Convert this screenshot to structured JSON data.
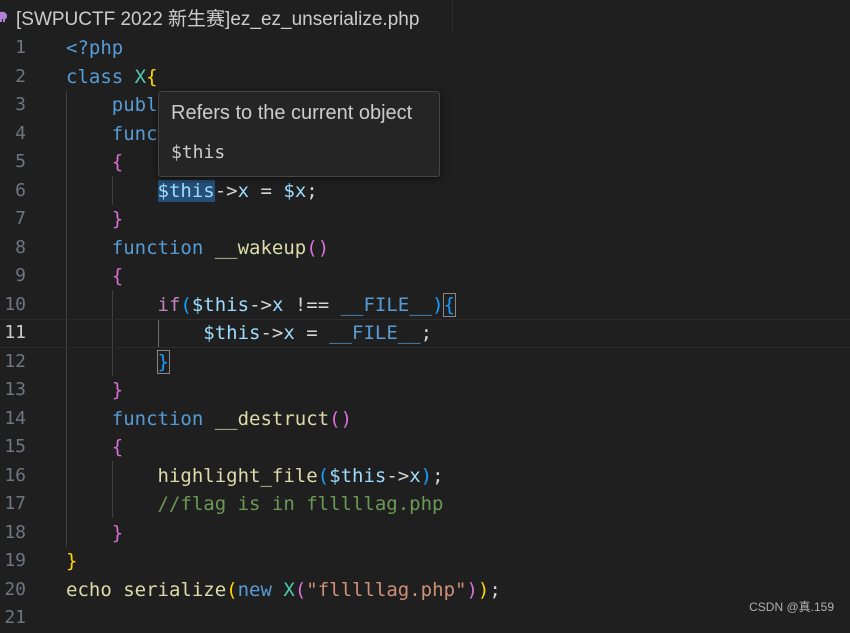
{
  "tab": {
    "title": "[SWPUCTF 2022 新生赛]ez_ez_unserialize.php",
    "icon": "php-elephant-icon"
  },
  "editor": {
    "line_numbers": [
      "1",
      "2",
      "3",
      "4",
      "5",
      "6",
      "7",
      "8",
      "9",
      "10",
      "11",
      "12",
      "13",
      "14",
      "15",
      "16",
      "17",
      "18",
      "19",
      "20",
      "21"
    ],
    "current_line": 11,
    "code": {
      "l1": "<?php",
      "l2_kw": "class",
      "l2_cls": "X",
      "l2_br": "{",
      "l3": "publ",
      "l4": "func",
      "l5": "{",
      "l6_var": "$this",
      "l6_op": "->",
      "l6_prop": "x",
      "l6_eq": " = ",
      "l6_var2": "$x",
      "l6_end": ";",
      "l7": "}",
      "l8_kw": "function",
      "l8_fn": "__wakeup",
      "l8_p": "()",
      "l9": "{",
      "l10_kw": "if",
      "l10_p1": "(",
      "l10_var": "$this",
      "l10_op": "->",
      "l10_prop": "x",
      "l10_cmp": " !== ",
      "l10_const": "__FILE__",
      "l10_p2": ")",
      "l10_br": "{",
      "l11_var": "$this",
      "l11_op": "->",
      "l11_prop": "x",
      "l11_eq": " = ",
      "l11_const": "__FILE__",
      "l11_end": ";",
      "l12": "}",
      "l13": "}",
      "l14_kw": "function",
      "l14_fn": "__destruct",
      "l14_p": "()",
      "l15": "{",
      "l16_fn": "highlight_file",
      "l16_p1": "(",
      "l16_var": "$this",
      "l16_op": "->",
      "l16_prop": "x",
      "l16_p2": ")",
      "l16_end": ";",
      "l17": "//flag is in flllllag.php",
      "l18": "}",
      "l19": "}",
      "l20_fn": "echo serialize",
      "l20_p1": "(",
      "l20_kw": "new",
      "l20_cls": "X",
      "l20_p2": "(",
      "l20_str": "\"flllllag.php\"",
      "l20_p3": ")",
      "l20_p4": ")",
      "l20_end": ";"
    }
  },
  "hover": {
    "description": "Refers to the current object",
    "code": "$this"
  },
  "watermark": "CSDN @真.159"
}
